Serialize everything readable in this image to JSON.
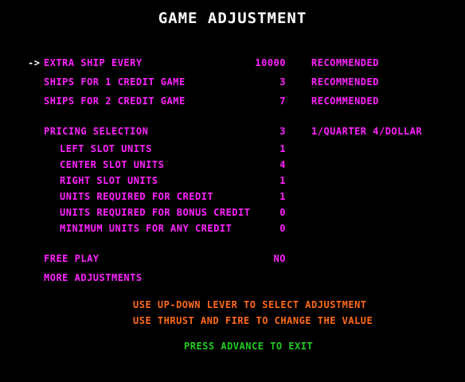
{
  "title": "GAME ADJUSTMENT",
  "cursor": "->",
  "rows": [
    {
      "label": "EXTRA SHIP EVERY",
      "value": "10000",
      "note": "RECOMMENDED"
    },
    {
      "label": "SHIPS FOR 1 CREDIT GAME",
      "value": "3",
      "note": "RECOMMENDED"
    },
    {
      "label": "SHIPS FOR 2 CREDIT GAME",
      "value": "7",
      "note": "RECOMMENDED"
    },
    {
      "label": "PRICING SELECTION",
      "value": "3",
      "note": "1/QUARTER 4/DOLLAR"
    },
    {
      "label": "LEFT SLOT UNITS",
      "value": "1"
    },
    {
      "label": "CENTER SLOT UNITS",
      "value": "4"
    },
    {
      "label": "RIGHT SLOT UNITS",
      "value": "1"
    },
    {
      "label": "UNITS REQUIRED FOR CREDIT",
      "value": "1"
    },
    {
      "label": "UNITS REQUIRED FOR BONUS CREDIT",
      "value": "0"
    },
    {
      "label": "MINIMUM UNITS FOR ANY CREDIT",
      "value": "0"
    },
    {
      "label": "FREE PLAY",
      "value": "NO"
    },
    {
      "label": "MORE ADJUSTMENTS"
    }
  ],
  "instructions": [
    "USE UP-DOWN LEVER TO SELECT ADJUSTMENT",
    "USE THRUST AND FIRE TO CHANGE THE VALUE"
  ],
  "exit_text": "PRESS ADVANCE TO EXIT",
  "colors": {
    "title": "#ffffff",
    "menu": "#ff22ff",
    "instructions": "#ff6a1a",
    "exit": "#22cc22",
    "background": "#000000"
  }
}
